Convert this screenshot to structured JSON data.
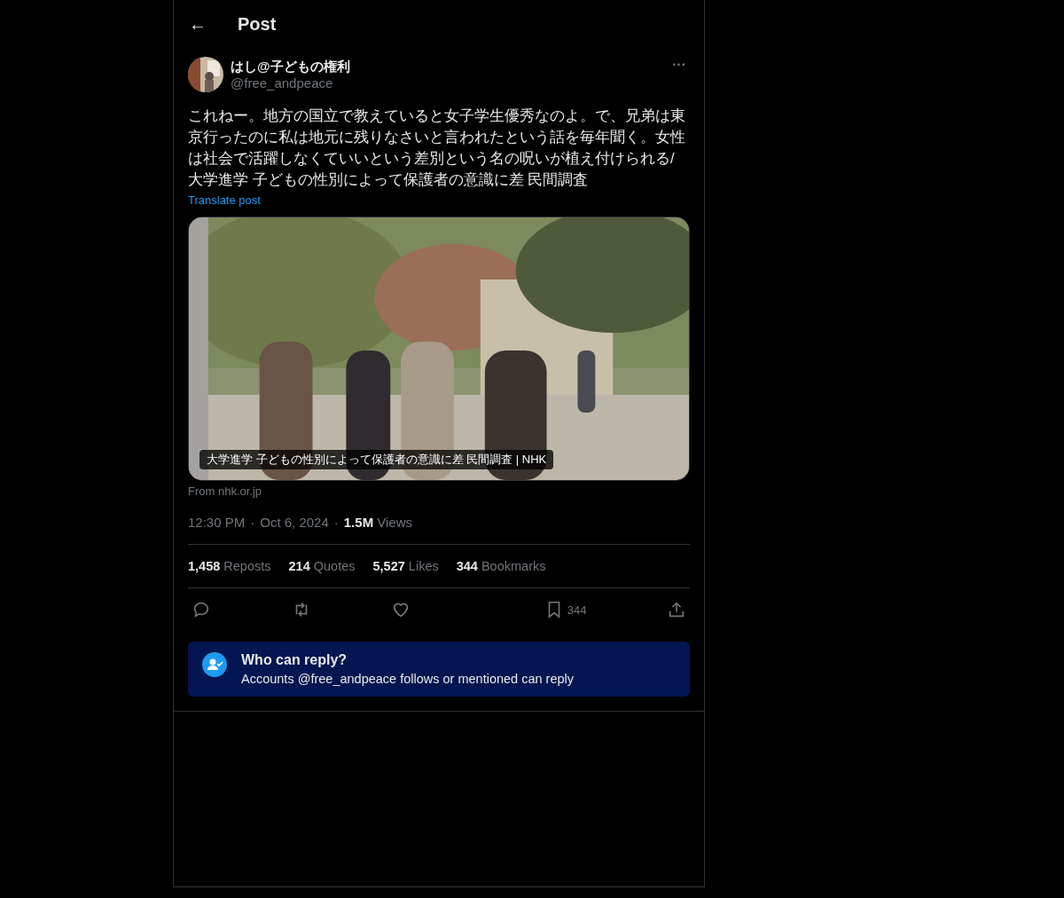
{
  "header": {
    "back": "←",
    "title": "Post"
  },
  "author": {
    "name": "はし@子どもの権利",
    "handle": "@free_andpeace",
    "more": "···"
  },
  "text": "これねー。地方の国立で教えていると女子学生優秀なのよ。で、兄弟は東京行ったのに私は地元に残りなさいと言われたという話を毎年聞く。女性は社会で活躍しなくていいという差別という名の呪いが植え付けられる/\n大学進学 子どもの性別によって保護者の意識に差 民間調査",
  "translate": "Translate post",
  "card": {
    "caption": "大学進学 子どもの性別によって保護者の意識に差 民間調査 | NHK",
    "source": "From nhk.or.jp"
  },
  "meta": {
    "time": "12:30 PM",
    "separators": [
      "·",
      "·"
    ],
    "date": "Oct 6, 2024",
    "views_count": "1.5M",
    "views_label": "Views"
  },
  "stats": [
    {
      "count": "1,458",
      "label": "Reposts"
    },
    {
      "count": "214",
      "label": "Quotes"
    },
    {
      "count": "5,527",
      "label": "Likes"
    },
    {
      "count": "344",
      "label": "Bookmarks"
    }
  ],
  "actions": [
    {
      "kind": "reply"
    },
    {
      "kind": "repost"
    },
    {
      "kind": "like"
    },
    {
      "kind": "bookmark",
      "count": "344"
    },
    {
      "kind": "share"
    }
  ],
  "reply_info": {
    "title": "Who can reply?",
    "text": "Accounts @free_andpeace follows or mentioned can reply"
  }
}
